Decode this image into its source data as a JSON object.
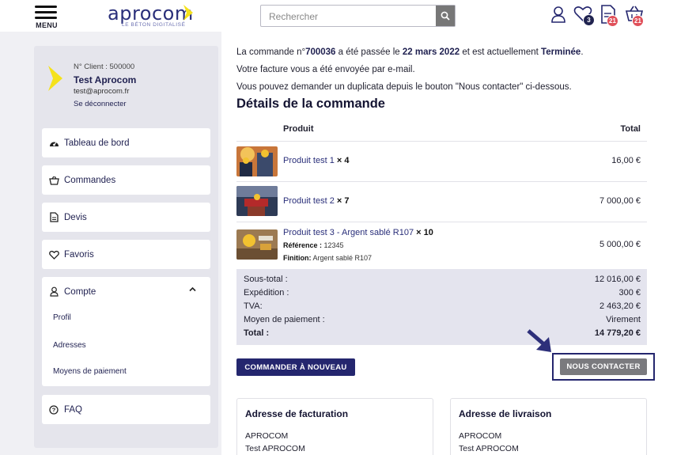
{
  "header": {
    "menu_label": "MENU",
    "logo_word": "aprocom",
    "logo_tagline": "LE BÉTON DIGITALISÉ",
    "search_placeholder": "Rechercher",
    "favorites_count": "3",
    "quotes_count": "21",
    "cart_count": "21",
    "colors": {
      "brand": "#24266e",
      "accent_yellow": "#f5e21b",
      "badge_red": "#e0505a"
    }
  },
  "sidebar": {
    "client_number": "N° Client : 500000",
    "name": "Test Aprocom",
    "email": "test@aprocom.fr",
    "logout": "Se déconnecter",
    "items": [
      {
        "label": "Tableau de bord",
        "icon": "dashboard-icon"
      },
      {
        "label": "Commandes",
        "icon": "basket-icon"
      },
      {
        "label": "Devis",
        "icon": "document-icon"
      },
      {
        "label": "Favoris",
        "icon": "heart-icon"
      }
    ],
    "account": {
      "label": "Compte",
      "icon": "user-icon",
      "sub": [
        "Profil",
        "Adresses",
        "Moyens de paiement"
      ]
    },
    "faq": "FAQ"
  },
  "order": {
    "line1_a": "La commande n°",
    "number": "700036",
    "line1_b": " a été passée le ",
    "date": "22 mars 2022",
    "line1_c": " et est actuellement ",
    "status": "Terminée",
    "line1_d": ".",
    "line2": "Votre facture vous a été envoyée par e-mail.",
    "line3": "Vous pouvez demander un duplicata depuis le bouton \"Nous contacter\" ci-dessous.",
    "details_title": "Détails de la commande",
    "col_product": "Produit",
    "col_total": "Total",
    "items": [
      {
        "name": "Produit test 1",
        "qty": " × 4",
        "price": "16,00 €"
      },
      {
        "name": "Produit test 2",
        "qty": " × 7",
        "price": "7 000,00 €"
      },
      {
        "name": "Produit test 3 - Argent sablé R107",
        "qty": " × 10",
        "price": "5 000,00 €",
        "ref_label": "Référence :",
        "ref_value": " 12345",
        "finish_label": "Finition:",
        "finish_value": " Argent sablé R107"
      }
    ],
    "totals": [
      {
        "label": "Sous-total :",
        "value": "12 016,00 €"
      },
      {
        "label": "Expédition :",
        "value": "300 €"
      },
      {
        "label": "TVA:",
        "value": "2 463,20 €"
      },
      {
        "label": "Moyen de paiement :",
        "value": "Virement"
      },
      {
        "label": "Total :",
        "value": "14 779,20 €"
      }
    ],
    "reorder_button": "COMMANDER À NOUVEAU",
    "contact_button": "NOUS CONTACTER"
  },
  "billing": {
    "title": "Adresse de facturation",
    "line1": "APROCOM",
    "line2": "Test APROCOM"
  },
  "shipping": {
    "title": "Adresse de livraison",
    "line1": "APROCOM",
    "line2": "Test APROCOM"
  }
}
